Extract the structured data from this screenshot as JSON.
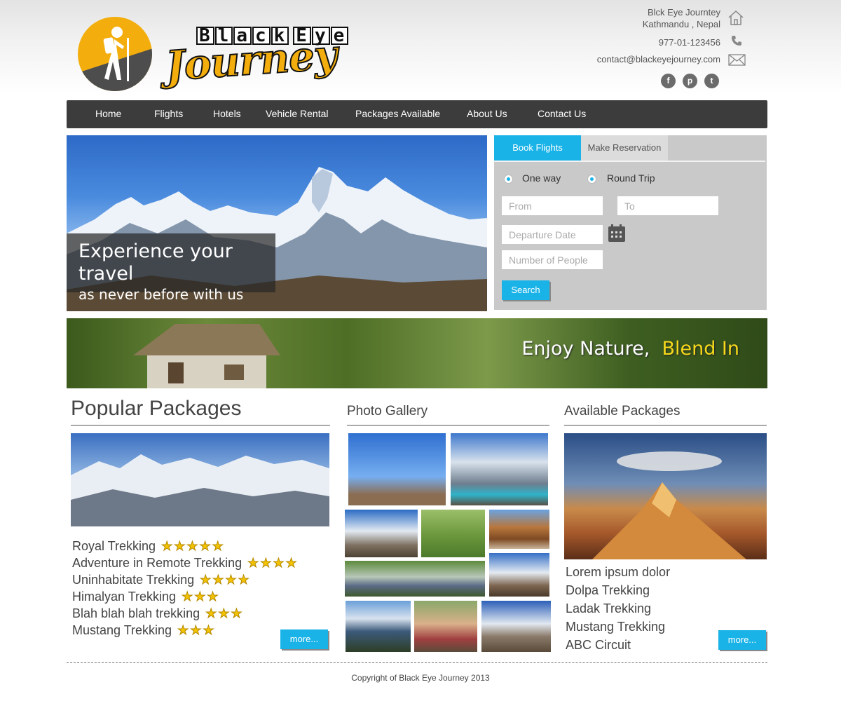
{
  "brand": {
    "word1": "Black Eye",
    "word2": "Journey"
  },
  "contact": {
    "line1": "Blck Eye Journtey",
    "line2": "Kathmandu , Nepal",
    "phone": "977-01-123456",
    "email": "contact@blackeyejourney.com"
  },
  "social": [
    {
      "icon": "facebook-icon",
      "glyph": "f"
    },
    {
      "icon": "pinterest-icon",
      "glyph": "p"
    },
    {
      "icon": "twitter-icon",
      "glyph": "t"
    }
  ],
  "nav": [
    "Home",
    "Flights",
    "Hotels",
    "Vehicle Rental",
    "Packages Available",
    "About Us",
    "Contact Us"
  ],
  "hero": {
    "line1": "Experience your travel",
    "line2": "as never before with us"
  },
  "booking": {
    "tabs": [
      "Book Flights",
      "Make Reservation"
    ],
    "trip_options": [
      "One way",
      "Round Trip"
    ],
    "placeholders": {
      "from": "From",
      "to": "To",
      "departure": "Departure Date",
      "people": "Number of People"
    },
    "search_label": "Search"
  },
  "banner": {
    "text": "Enjoy Nature,",
    "highlight": "Blend In"
  },
  "popular": {
    "title": "Popular Packages",
    "items": [
      {
        "name": "Royal Trekking",
        "stars": "★★★★★"
      },
      {
        "name": "Adventure in Remote Trekking",
        "stars": "★★★★"
      },
      {
        "name": "Uninhabitate Trekking",
        "stars": "★★★★"
      },
      {
        "name": "Himalyan Trekking",
        "stars": "★★★"
      },
      {
        "name": "Blah blah blah trekking",
        "stars": "★★★"
      },
      {
        "name": "Mustang Trekking",
        "stars": "★★★"
      }
    ],
    "more": "more..."
  },
  "gallery": {
    "title": "Photo Gallery"
  },
  "available": {
    "title": "Available Packages",
    "items": [
      "Lorem ipsum dolor",
      "Dolpa Trekking",
      "Ladak Trekking",
      "Mustang Trekking",
      "ABC Circuit"
    ],
    "more": "more..."
  },
  "footer": {
    "copyright": "Copyright of Black Eye Journey 2013"
  },
  "colors": {
    "accent": "#1ab3e8",
    "brand_yellow": "#f3ae0d",
    "nav_bg": "#3c3c3c"
  }
}
